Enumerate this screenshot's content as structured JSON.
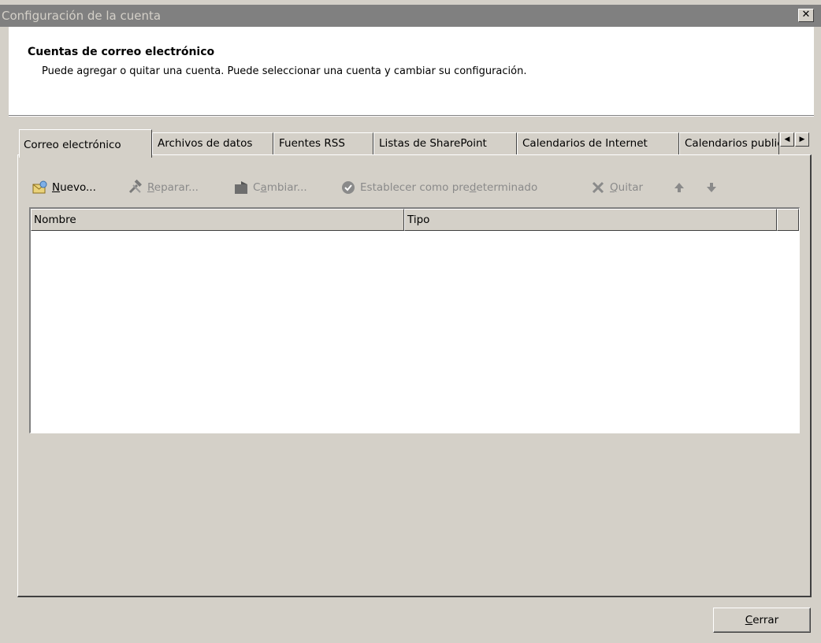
{
  "window": {
    "title": "Configuración de la cuenta",
    "close_glyph": "✕"
  },
  "header": {
    "title": "Cuentas de correo electrónico",
    "subtitle": "Puede agregar o quitar una cuenta. Puede seleccionar una cuenta y cambiar su configuración."
  },
  "tabs": [
    {
      "label": "Correo electrónico",
      "active": true
    },
    {
      "label": "Archivos de datos",
      "active": false
    },
    {
      "label": "Fuentes RSS",
      "active": false
    },
    {
      "label": "Listas de SharePoint",
      "active": false
    },
    {
      "label": "Calendarios de Internet",
      "active": false
    },
    {
      "label": "Calendarios publicados",
      "active": false
    }
  ],
  "tab_scroll": {
    "left_icon": "triangle-left-icon",
    "right_icon": "triangle-right-icon"
  },
  "toolbar": {
    "new": {
      "key": "N",
      "rest": "uevo...",
      "icon": "new-mail-icon",
      "enabled": true
    },
    "repair": {
      "key": "R",
      "rest": "eparar...",
      "icon": "wrench-hammer-icon",
      "enabled": false
    },
    "change_pre": "C",
    "change_key": "a",
    "change_post": "mbiar...",
    "change_icon": "change-account-icon",
    "default_pre": "Establecer como pre",
    "default_key": "d",
    "default_post": "eterminado",
    "default_icon": "checkmark-circle-icon",
    "remove": {
      "key": "Q",
      "rest": "uitar",
      "icon": "x-remove-icon",
      "enabled": false
    },
    "up_icon": "arrow-up-icon",
    "down_icon": "arrow-down-icon"
  },
  "list": {
    "columns": [
      "Nombre",
      "Tipo"
    ],
    "rows": []
  },
  "footer": {
    "close_key": "C",
    "close_rest": "errar"
  },
  "colors": {
    "face": "#d4d0c8",
    "titlebar_inactive": "#808080",
    "disabled_text": "#8a8a8a"
  }
}
